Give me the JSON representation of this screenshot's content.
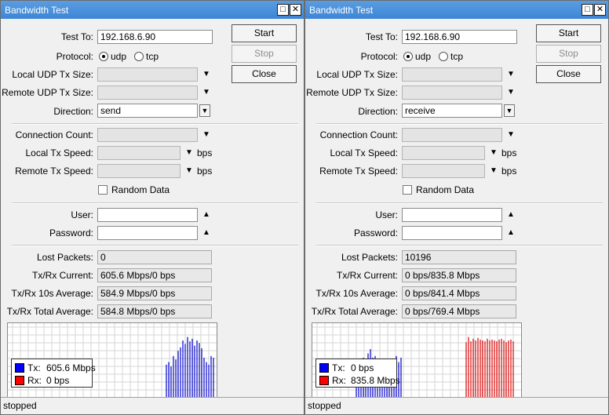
{
  "windows": [
    {
      "title": "Bandwidth Test",
      "test_to": "192.168.6.90",
      "protocol_label": "Protocol:",
      "protocol_options": [
        "udp",
        "tcp"
      ],
      "protocol_selected": "udp",
      "local_udp_tx_size": "",
      "remote_udp_tx_size": "",
      "direction": "send",
      "connection_count": "",
      "local_tx_speed": "",
      "remote_tx_speed": "",
      "random_data": false,
      "user": "",
      "password": "",
      "lost_packets": "0",
      "txrx_current": "605.6 Mbps/0 bps",
      "txrx_10s_average": "584.9 Mbps/0 bps",
      "txrx_total_average": "584.8 Mbps/0 bps",
      "legend_tx": "605.6 Mbps",
      "legend_rx": "0 bps",
      "status": "stopped",
      "graph_tx_bars": [
        0.52,
        0.55,
        0.5,
        0.62,
        0.58,
        0.68,
        0.72,
        0.8,
        0.76,
        0.84,
        0.79,
        0.82,
        0.74,
        0.8,
        0.77,
        0.71,
        0.6,
        0.55,
        0.52,
        0.62,
        0.6
      ],
      "graph_rx_bars": []
    },
    {
      "title": "Bandwidth Test",
      "test_to": "192.168.6.90",
      "protocol_label": "Protocol:",
      "protocol_options": [
        "udp",
        "tcp"
      ],
      "protocol_selected": "udp",
      "local_udp_tx_size": "",
      "remote_udp_tx_size": "",
      "direction": "receive",
      "connection_count": "",
      "local_tx_speed": "",
      "remote_tx_speed": "",
      "random_data": false,
      "user": "",
      "password": "",
      "lost_packets": "10196",
      "txrx_current": "0 bps/835.8 Mbps",
      "txrx_10s_average": "0 bps/841.4 Mbps",
      "txrx_total_average": "0 bps/769.4 Mbps",
      "legend_tx": "0 bps",
      "legend_rx": "835.8 Mbps",
      "status": "stopped",
      "graph_tx_bars_left": [
        0.42,
        0.48,
        0.55,
        0.6,
        0.55,
        0.65,
        0.7,
        0.6,
        0.62,
        0.56,
        0.5,
        0.45,
        0.4,
        0.35,
        0.3,
        0.38,
        0.5,
        0.62,
        0.55,
        0.6
      ],
      "graph_rx_bars": [
        0.78,
        0.84,
        0.79,
        0.82,
        0.8,
        0.83,
        0.81,
        0.8,
        0.79,
        0.82,
        0.8,
        0.81,
        0.8,
        0.79,
        0.81,
        0.82,
        0.8,
        0.78,
        0.8,
        0.81,
        0.79
      ]
    }
  ],
  "labels": {
    "test_to": "Test To:",
    "local_udp_tx_size": "Local UDP Tx Size:",
    "remote_udp_tx_size": "Remote UDP Tx Size:",
    "direction": "Direction:",
    "connection_count": "Connection Count:",
    "local_tx_speed": "Local Tx Speed:",
    "remote_tx_speed": "Remote Tx Speed:",
    "bps": "bps",
    "random_data": "Random Data",
    "user": "User:",
    "password": "Password:",
    "lost_packets": "Lost Packets:",
    "txrx_current": "Tx/Rx Current:",
    "txrx_10s_average": "Tx/Rx 10s Average:",
    "txrx_total_average": "Tx/Rx Total Average:",
    "tx": "Tx:",
    "rx": "Rx:"
  },
  "buttons": {
    "start": "Start",
    "stop": "Stop",
    "close": "Close"
  },
  "colors": {
    "tx": "#0000cc",
    "rx": "#dd0000",
    "legend_tx": "#0000ff",
    "legend_rx": "#ff0000",
    "title_bar": "#4a92dc"
  }
}
